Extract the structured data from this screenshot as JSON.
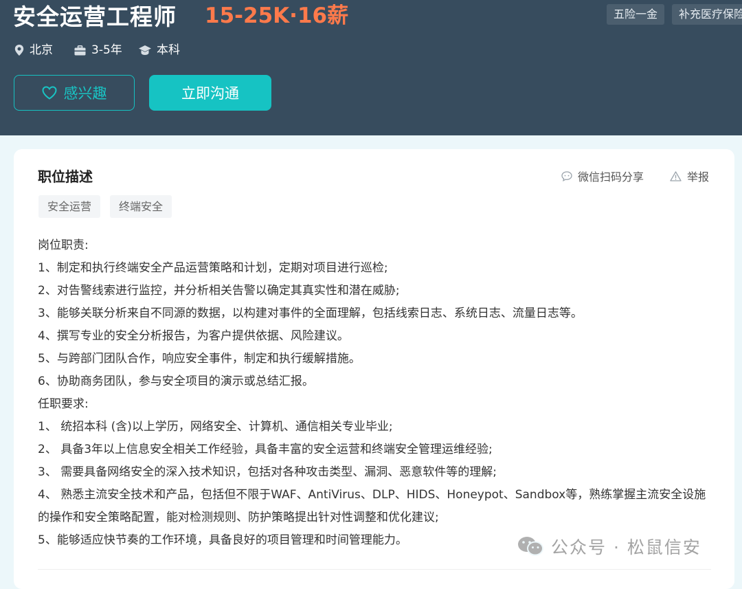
{
  "header": {
    "title": "安全运营工程师",
    "salary": "15-25K·16薪",
    "benefits": [
      "五险一金",
      "补充医疗保险"
    ],
    "meta": {
      "city": "北京",
      "experience": "3-5年",
      "education": "本科"
    },
    "buttons": {
      "interest": "感兴趣",
      "chat": "立即沟通"
    }
  },
  "card": {
    "section_title": "职位描述",
    "actions": {
      "share": "微信扫码分享",
      "report": "举报"
    },
    "tags": [
      "安全运营",
      "终端安全"
    ],
    "description": [
      "岗位职责:",
      "1、制定和执行终端安全产品运营策略和计划，定期对项目进行巡检;",
      "2、对告警线索进行监控，并分析相关告警以确定其真实性和潜在威胁;",
      "3、能够关联分析来自不同源的数据，以构建对事件的全面理解，包括线索日志、系统日志、流量日志等。",
      "4、撰写专业的安全分析报告，为客户提供依据、风险建议。",
      "5、与跨部门团队合作，响应安全事件，制定和执行缓解措施。",
      "6、协助商务团队，参与安全项目的演示或总结汇报。",
      "任职要求:",
      "1、 统招本科 (含)以上学历，网络安全、计算机、通信相关专业毕业;",
      "2、 具备3年以上信息安全相关工作经验，具备丰富的安全运营和终端安全管理运维经验;",
      "3、 需要具备网络安全的深入技术知识，包括对各种攻击类型、漏洞、恶意软件等的理解;",
      "4、 熟悉主流安全技术和产品，包括但不限于WAF、AntiVirus、DLP、HIDS、Honeypot、Sandbox等，熟练掌握主流安全设施的操作和安全策略配置，能对检测规则、防护策略提出针对性调整和优化建议;",
      "5、能够适应快节奏的工作环境，具备良好的项目管理和时间管理能力。"
    ]
  },
  "watermark": "公众号 · 松鼠信安",
  "icons": {
    "city": "location-pin-icon",
    "experience": "briefcase-icon",
    "education": "graduation-cap-icon",
    "interest": "heart-icon",
    "share": "chat-bubble-icon",
    "report": "warning-icon",
    "watermark": "wechat-icon"
  },
  "colors": {
    "header_bg": "#374c5e",
    "salary": "#fe7a4b",
    "accent": "#16c3c3"
  }
}
